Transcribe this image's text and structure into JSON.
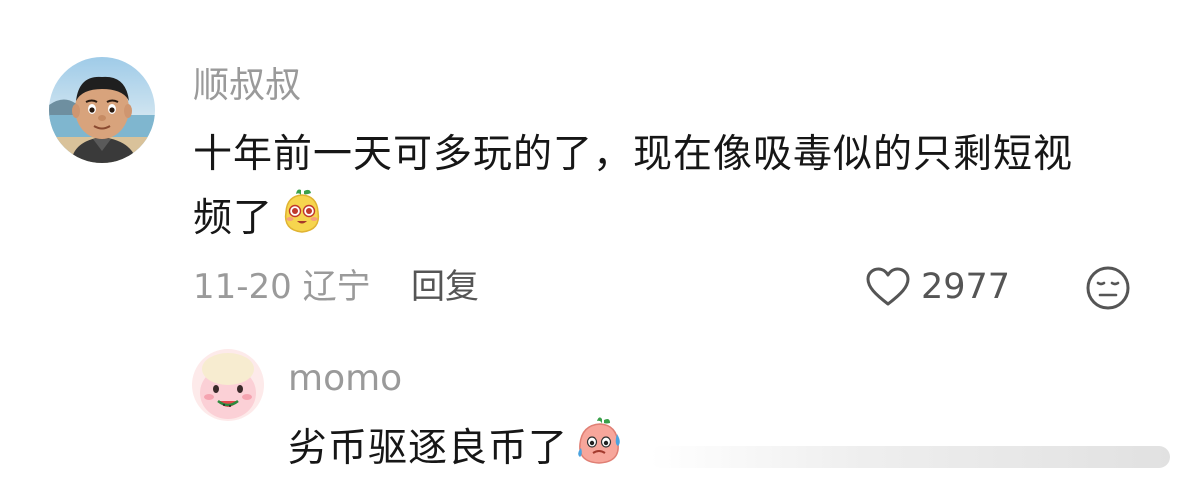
{
  "main_comment": {
    "username": "顺叔叔",
    "text_line1": "十年前一天可多玩的了，现在像吸毒似的只剩短视",
    "text_line2": "频了",
    "emoji": "pear-face-emoji",
    "date_location": "11-20 辽宁",
    "reply_label": "回复",
    "like_count": "2977",
    "like_icon": "heart-outline-icon",
    "dislike_icon": "neutral-face-icon"
  },
  "reply_comment": {
    "username": "momo",
    "text": "劣币驱逐良币了",
    "emoji": "sweating-peach-emoji"
  },
  "colors": {
    "username": "#9a9a9a",
    "text": "#161616",
    "meta": "#9a9a9a",
    "action": "#555555"
  }
}
